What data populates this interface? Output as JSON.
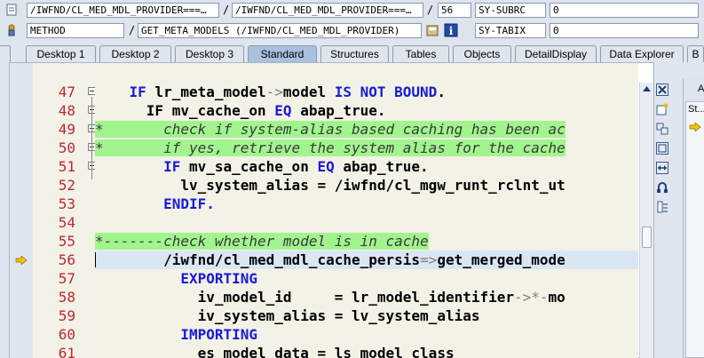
{
  "context": {
    "program_field": "/IWFND/CL_MED_MDL_PROVIDER===…",
    "include_field": "/IWFND/CL_MED_MDL_PROVIDER===…",
    "line_field": "56",
    "var1_name": "SY-SUBRC",
    "var1_value": "0",
    "type_field": "METHOD",
    "method_field": "GET_META_MODELS (/IWFND/CL_MED_MDL_PROVIDER)",
    "var2_name": "SY-TABIX",
    "var2_value": "0"
  },
  "tabs": [
    {
      "label": "Desktop 1"
    },
    {
      "label": "Desktop 2"
    },
    {
      "label": "Desktop 3"
    },
    {
      "label": "Standard",
      "active": true
    },
    {
      "label": "Structures"
    },
    {
      "label": "Tables"
    },
    {
      "label": "Objects"
    },
    {
      "label": "DetailDisplay"
    },
    {
      "label": "Data Explorer"
    },
    {
      "label": "B"
    }
  ],
  "code_lines": [
    {
      "num": "47",
      "fold": true,
      "comment": false,
      "current": false,
      "segs": [
        [
          "sp",
          "    "
        ],
        [
          "kw",
          "IF"
        ],
        [
          "txt",
          " lr_meta_model"
        ],
        [
          "op",
          "->"
        ],
        [
          "txt",
          "model "
        ],
        [
          "kw",
          "IS NOT BOUND"
        ],
        [
          "txt",
          "."
        ]
      ]
    },
    {
      "num": "48",
      "fold": true,
      "comment": false,
      "current": false,
      "segs": [
        [
          "sp",
          "      "
        ],
        [
          "txt",
          "IF mv_cache_on "
        ],
        [
          "kw",
          "EQ"
        ],
        [
          "txt",
          " abap_true."
        ]
      ]
    },
    {
      "num": "49",
      "fold": true,
      "comment": true,
      "current": false,
      "segs": [
        [
          "cm",
          "*       check if system-alias based caching has been ac"
        ]
      ]
    },
    {
      "num": "50",
      "fold": true,
      "comment": true,
      "current": false,
      "segs": [
        [
          "cm",
          "*       if yes, retrieve the system alias for the cache"
        ]
      ]
    },
    {
      "num": "51",
      "fold": true,
      "comment": false,
      "current": false,
      "segs": [
        [
          "sp",
          "        "
        ],
        [
          "kw",
          "IF"
        ],
        [
          "txt",
          " mv_sa_cache_on "
        ],
        [
          "kw",
          "EQ"
        ],
        [
          "txt",
          " abap_true."
        ]
      ]
    },
    {
      "num": "52",
      "fold": false,
      "comment": false,
      "current": false,
      "segs": [
        [
          "sp",
          "          "
        ],
        [
          "txt",
          "lv_system_alias = /iwfnd/cl_mgw_runt_rclnt_ut"
        ]
      ]
    },
    {
      "num": "53",
      "fold": false,
      "comment": false,
      "current": false,
      "segs": [
        [
          "sp",
          "        "
        ],
        [
          "kw",
          "ENDIF."
        ]
      ]
    },
    {
      "num": "54",
      "fold": false,
      "comment": false,
      "current": false,
      "segs": [
        [
          "sp",
          " "
        ]
      ]
    },
    {
      "num": "55",
      "fold": false,
      "comment": true,
      "current": false,
      "segs": [
        [
          "cm",
          "*-------check whether model is in cache"
        ]
      ]
    },
    {
      "num": "56",
      "fold": false,
      "comment": false,
      "current": true,
      "segs": [
        [
          "sp",
          "        "
        ],
        [
          "txt",
          "/iwfnd/cl_med_mdl_cache_persis"
        ],
        [
          "op",
          "=>"
        ],
        [
          "txt",
          "get_merged_mode"
        ]
      ]
    },
    {
      "num": "57",
      "fold": false,
      "comment": false,
      "current": false,
      "segs": [
        [
          "sp",
          "          "
        ],
        [
          "kw",
          "EXPORTING"
        ]
      ]
    },
    {
      "num": "58",
      "fold": false,
      "comment": false,
      "current": false,
      "segs": [
        [
          "sp",
          "            "
        ],
        [
          "txt",
          "iv_model_id     = lr_model_identifier"
        ],
        [
          "op",
          "->*-"
        ],
        [
          "txt",
          "mo"
        ]
      ]
    },
    {
      "num": "59",
      "fold": false,
      "comment": false,
      "current": false,
      "segs": [
        [
          "sp",
          "            "
        ],
        [
          "txt",
          "iv_system_alias = lv_system_alias"
        ]
      ]
    },
    {
      "num": "60",
      "fold": false,
      "comment": false,
      "current": false,
      "segs": [
        [
          "sp",
          "          "
        ],
        [
          "kw",
          "IMPORTING"
        ]
      ]
    },
    {
      "num": "61",
      "fold": false,
      "comment": false,
      "current": false,
      "segs": [
        [
          "sp",
          "            "
        ],
        [
          "txt",
          "es_model_data = ls_model_class"
        ]
      ]
    }
  ],
  "side_panel": {
    "header": "A",
    "label": "St..."
  },
  "colors": {
    "comment_bg": "#a2f58e",
    "keyword": "#1a1ad6",
    "line_number": "#c1262b",
    "current_line_bg": "#dbe6f5",
    "active_tab": "#a9c0de"
  }
}
